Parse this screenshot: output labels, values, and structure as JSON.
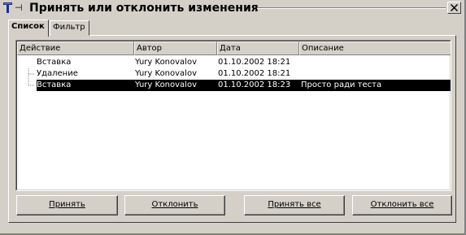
{
  "window": {
    "title": "Принять или отклонить изменения"
  },
  "tabs": [
    {
      "label": "Список",
      "active": true
    },
    {
      "label": "Фильтр",
      "active": false
    }
  ],
  "table": {
    "columns": [
      "Действие",
      "Автор",
      "Дата",
      "Описание"
    ],
    "rows": [
      {
        "action": "Вставка",
        "author": "Yury Konovalov",
        "date": "01.10.2002 18:21",
        "comment": "",
        "selected": false
      },
      {
        "action": "Удаление",
        "author": "Yury Konovalov",
        "date": "01.10.2002 18:21",
        "comment": "",
        "selected": false
      },
      {
        "action": "Вставка",
        "author": "Yury Konovalov",
        "date": "01.10.2002 18:23",
        "comment": "Просто ради теста",
        "selected": true
      }
    ]
  },
  "buttons": {
    "accept": "Принять",
    "reject": "Отклонить",
    "accept_all": "Принять все",
    "reject_all": "Отклонить все"
  },
  "colors": {
    "face": "#d4d0c8",
    "selection": "#000000",
    "list_bg": "#ffffff"
  }
}
